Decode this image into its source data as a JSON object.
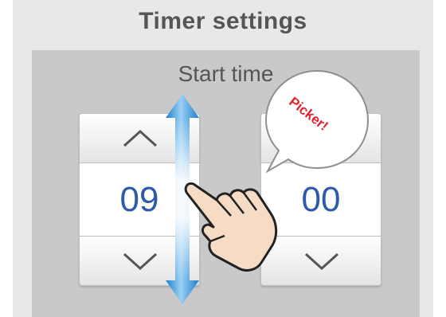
{
  "title": "Timer settings",
  "subtitle": "Start time",
  "pickers": {
    "hour": {
      "value": "09",
      "up_icon": "chevron-up-icon",
      "down_icon": "chevron-down-icon"
    },
    "minute": {
      "value": "00",
      "up_icon": "chevron-up-icon",
      "down_icon": "chevron-down-icon"
    }
  },
  "callout": {
    "text": "Picker!"
  },
  "colors": {
    "value_text": "#2b5ba9",
    "arrow": "#2f90d8",
    "callout_text": "#e0222d",
    "hand_fill": "#f7dcc5"
  }
}
